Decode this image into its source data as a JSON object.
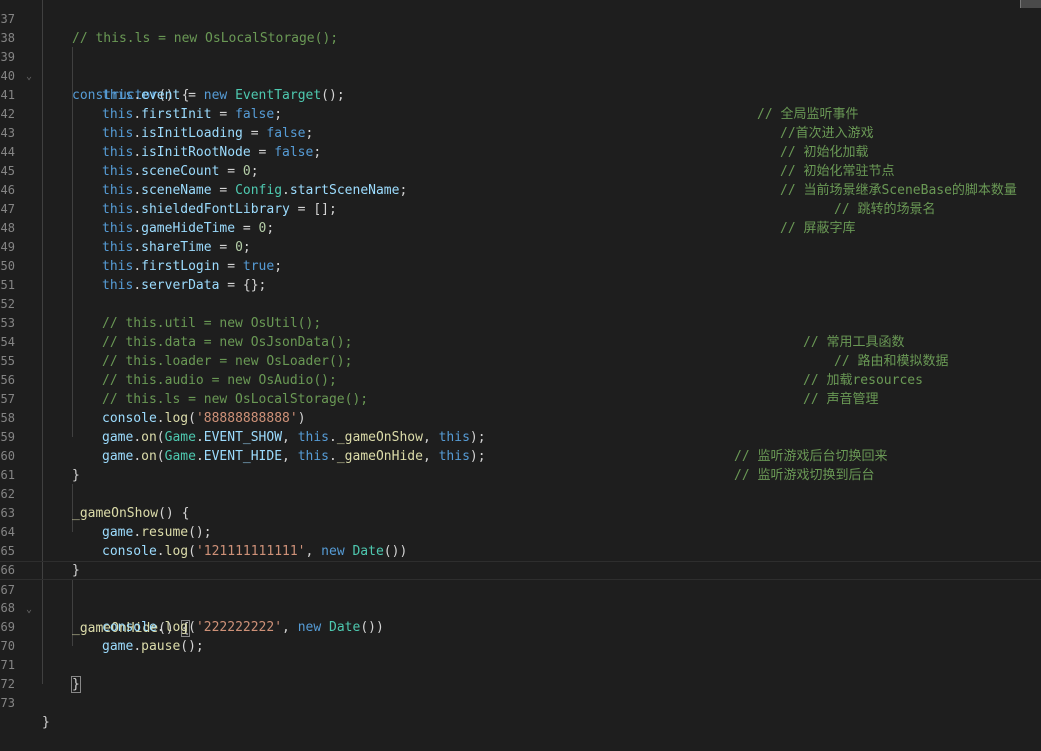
{
  "comments": {
    "c36": "// this.ls = new OsLocalStorage();",
    "c40": "// 全局监听事件",
    "c41": "//首次进入游戏",
    "c42": "// 初始化加载",
    "c43": "// 初始化常驻节点",
    "c44": "// 当前场景继承SceneBase的脚本数量",
    "c45": "// 跳转的场景名",
    "c46": "// 屏蔽字库",
    "c52": "// 常用工具函数",
    "c53": "// 路由和模拟数据",
    "c54": "// 加载resources",
    "c55": "// 声音管理",
    "c58": "// 监听游戏后台切换回来",
    "c59": "// 监听游戏切换到后台"
  },
  "code": {
    "constructor": "constructor",
    "event": "event",
    "EventTarget": "EventTarget",
    "firstInit": "firstInit",
    "isInitLoading": "isInitLoading",
    "isInitRootNode": "isInitRootNode",
    "sceneCount": "sceneCount",
    "sceneName": "sceneName",
    "Config": "Config",
    "startSceneName": "startSceneName",
    "shieldedFontLibrary": "shieldedFontLibrary",
    "gameHideTime": "gameHideTime",
    "shareTime": "shareTime",
    "firstLogin": "firstLogin",
    "serverData": "serverData",
    "cm52": "// this.util = new OsUtil();",
    "cm53": "// this.data = new OsJsonData();",
    "cm54": "// this.loader = new OsLoader();",
    "cm55": "// this.audio = new OsAudio();",
    "cm56": "// this.ls = new OsLocalStorage();",
    "str57": "'88888888888'",
    "str64": "'121111111111'",
    "str68": "'222222222'",
    "gameOnShow": "_gameOnShow",
    "gameOnHide": "_gameOnHide",
    "resume": "resume",
    "pause": "pause",
    "EVENT_SHOW": "EVENT_SHOW",
    "EVENT_HIDE": "EVENT_HIDE"
  }
}
